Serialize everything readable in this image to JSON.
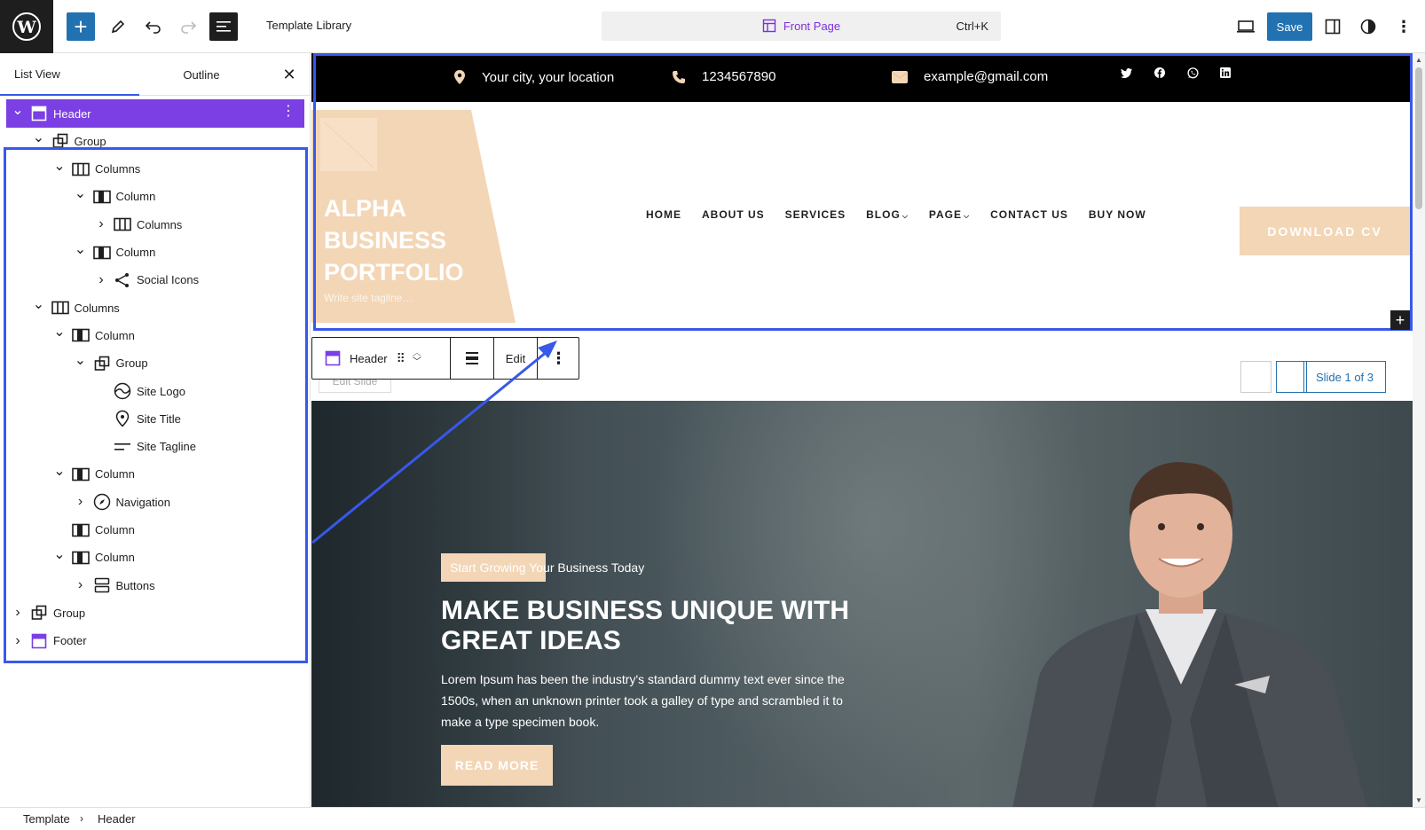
{
  "topbar": {
    "title": "Template Library",
    "command_label": "Front Page",
    "command_shortcut": "Ctrl+K",
    "save_label": "Save"
  },
  "sidebar": {
    "tabs": [
      {
        "label": "List View",
        "active": true
      },
      {
        "label": "Outline",
        "active": false
      }
    ],
    "tree": [
      {
        "label": "Header",
        "level": 0,
        "icon": "template-part-icon",
        "chevron": "down",
        "selected": true
      },
      {
        "label": "Group",
        "level": 1,
        "icon": "group-icon",
        "chevron": "down"
      },
      {
        "label": "Columns",
        "level": 2,
        "icon": "columns-icon",
        "chevron": "down"
      },
      {
        "label": "Column",
        "level": 3,
        "icon": "column-icon",
        "chevron": "down"
      },
      {
        "label": "Columns",
        "level": 4,
        "icon": "columns-icon",
        "chevron": "right"
      },
      {
        "label": "Column",
        "level": 3,
        "icon": "column-icon",
        "chevron": "down"
      },
      {
        "label": "Social Icons",
        "level": 4,
        "icon": "share-icon",
        "chevron": "right"
      },
      {
        "label": "Columns",
        "level": 1,
        "icon": "columns-icon",
        "chevron": "down"
      },
      {
        "label": "Column",
        "level": 2,
        "icon": "column-icon",
        "chevron": "down"
      },
      {
        "label": "Group",
        "level": 3,
        "icon": "group-icon",
        "chevron": "down"
      },
      {
        "label": "Site Logo",
        "level": 4,
        "icon": "site-logo-icon",
        "chevron": "none"
      },
      {
        "label": "Site Title",
        "level": 4,
        "icon": "map-marker-icon",
        "chevron": "none"
      },
      {
        "label": "Site Tagline",
        "level": 4,
        "icon": "tagline-icon",
        "chevron": "none"
      },
      {
        "label": "Column",
        "level": 2,
        "icon": "column-icon",
        "chevron": "down"
      },
      {
        "label": "Navigation",
        "level": 3,
        "icon": "compass-icon",
        "chevron": "right"
      },
      {
        "label": "Column",
        "level": 2,
        "icon": "column-icon",
        "chevron": "none"
      },
      {
        "label": "Column",
        "level": 2,
        "icon": "column-icon",
        "chevron": "down"
      },
      {
        "label": "Buttons",
        "level": 3,
        "icon": "buttons-icon",
        "chevron": "right"
      },
      {
        "label": "Group",
        "level": 0,
        "icon": "group-icon",
        "chevron": "right"
      },
      {
        "label": "Footer",
        "level": 0,
        "icon": "template-part-icon",
        "chevron": "right"
      }
    ]
  },
  "site": {
    "location": "Your city, your location",
    "phone": "1234567890",
    "email": "example@gmail.com",
    "social_icons": [
      "twitter-icon",
      "facebook-icon",
      "whatsapp-icon",
      "linkedin-icon"
    ],
    "site_title": "ALPHA BUSINESS PORTFOLIO",
    "tagline_placeholder": "Write site tagline…",
    "nav": [
      "HOME",
      "ABOUT US",
      "SERVICES",
      "BLOG",
      "PAGE",
      "CONTACT US",
      "BUY NOW"
    ],
    "download_label": "DOWNLOAD CV",
    "accent_color": "#f3d6b6"
  },
  "block_toolbar": {
    "label": "Header",
    "edit_label": "Edit"
  },
  "slider": {
    "edit_slide_label": "Edit Slide",
    "slide_label": "Slide 1 of 3"
  },
  "hero": {
    "badge": "Start Growing Your Business Today",
    "title": "MAKE BUSINESS UNIQUE WITH GREAT IDEAS",
    "description": "Lorem Ipsum has been the industry's standard dummy text ever since the 1500s, when an unknown printer took a galley of type and scrambled it to make a type specimen book.",
    "button": "READ MORE"
  },
  "breadcrumb": [
    "Template",
    "Header"
  ]
}
